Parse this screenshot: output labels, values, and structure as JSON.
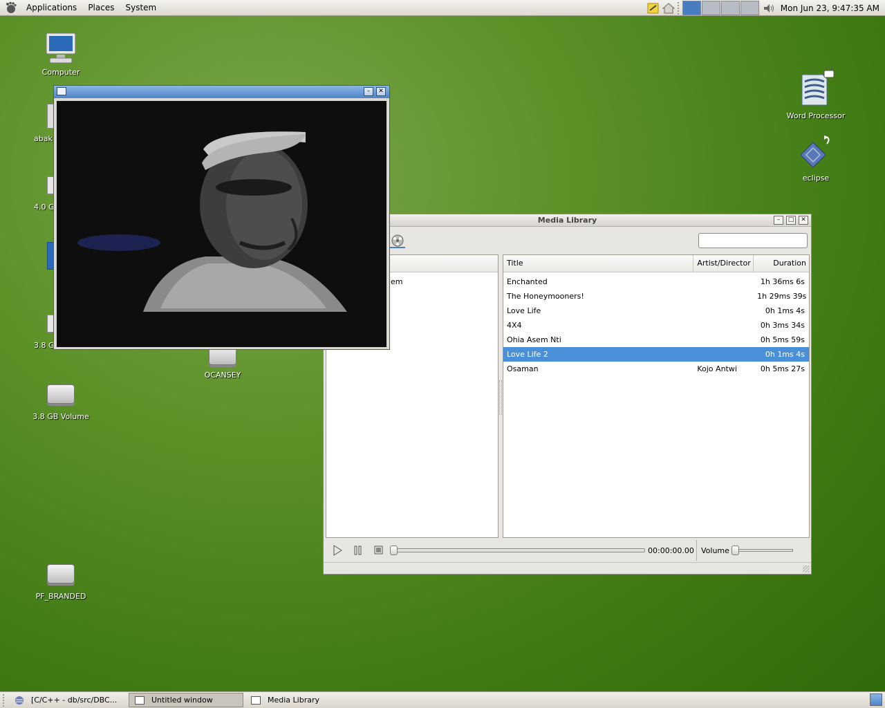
{
  "top_panel": {
    "menus": [
      "Applications",
      "Places",
      "System"
    ],
    "clock": "Mon Jun 23,  9:47:35 AM"
  },
  "desktop_icons": {
    "computer": "Computer",
    "abak": "abak",
    "vol40": "4.0 G",
    "vol38a": "3.8 G",
    "ocansey": "OCANSEY",
    "vol38b": "3.8 GB Volume",
    "pf": "PF_BRANDED",
    "word": "Word Processor",
    "eclipse": "eclipse"
  },
  "media_library": {
    "title": "Media Library",
    "left_partial_item": "em",
    "columns": {
      "title": "Title",
      "artist": "Artist/Director",
      "duration": "Duration"
    },
    "rows": [
      {
        "title": "Enchanted",
        "artist": "",
        "duration": "1h 36ms 6s"
      },
      {
        "title": "The Honeymooners!",
        "artist": "",
        "duration": "1h 29ms 39s"
      },
      {
        "title": "Love Life",
        "artist": "",
        "duration": "0h 1ms 4s"
      },
      {
        "title": "4X4",
        "artist": "",
        "duration": "0h 3ms 34s"
      },
      {
        "title": "Ohia Asem Nti",
        "artist": "",
        "duration": "0h 5ms 59s"
      },
      {
        "title": "Love Life 2",
        "artist": "",
        "duration": "0h 1ms 4s",
        "selected": true
      },
      {
        "title": "Osaman",
        "artist": "Kojo Antwi",
        "duration": "0h 5ms 27s"
      }
    ],
    "time": "00:00:00.00",
    "volume_label": "Volume"
  },
  "taskbar": {
    "tasks": [
      "[C/C++ - db/src/DBC...",
      "Untitled window",
      "Media Library"
    ],
    "active_index": 1
  },
  "colors": {
    "selection": "#4a90d9",
    "titlebar_active": "#4f84c8"
  }
}
